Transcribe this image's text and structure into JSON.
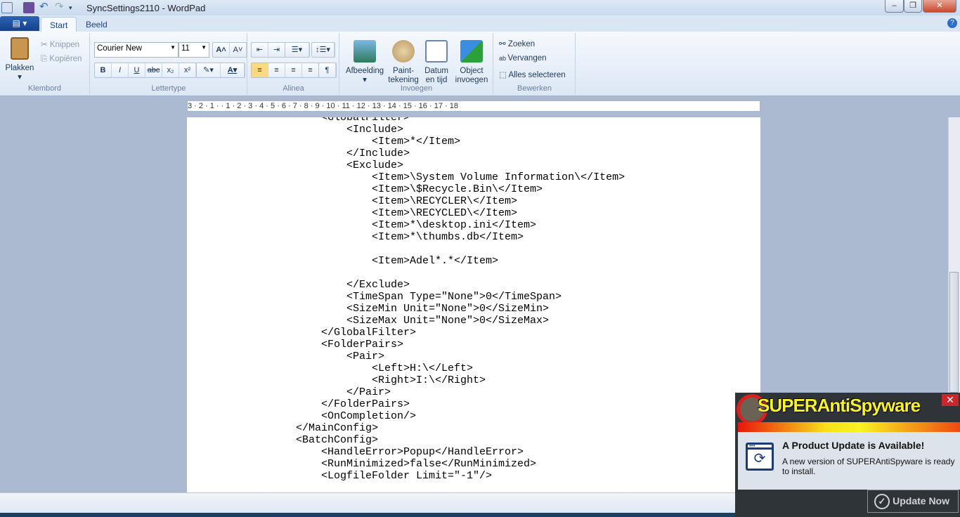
{
  "window": {
    "title": "SyncSettings2110 - WordPad"
  },
  "tabs": [
    {
      "label": "Start"
    },
    {
      "label": "Beeld"
    }
  ],
  "ribbon": {
    "clipboard": {
      "label": "Klembord",
      "paste": "Plakken",
      "cut": "Knippen",
      "copy": "Kopiëren"
    },
    "font": {
      "label": "Lettertype",
      "family": "Courier New",
      "size": "11",
      "buttons": [
        "B",
        "I",
        "U",
        "abc",
        "x₂",
        "x²"
      ]
    },
    "paragraph": {
      "label": "Alinea"
    },
    "insert": {
      "label": "Invoegen",
      "picture": "Afbeelding",
      "paint": "Paint-\ntekening",
      "datetime": "Datum\nen tijd",
      "object": "Object\ninvoegen"
    },
    "edit": {
      "label": "Bewerken",
      "find": "Zoeken",
      "replace": "Vervangen",
      "select_all": "Alles selecteren"
    }
  },
  "ruler": "3 · 2 · 1 · · 1 · 2 · 3 · 4 · 5 · 6 · 7 · 8 · 9 · 10 · 11 · 12 · 13 · 14 · 15 · 16 · 17 · 18",
  "document": {
    "lines": [
      "    <GlobalFilter>",
      "        <Include>",
      "            <Item>*</Item>",
      "        </Include>",
      "        <Exclude>",
      "            <Item>\\System Volume Information\\</Item>",
      "            <Item>\\$Recycle.Bin\\</Item>",
      "            <Item>\\RECYCLER\\</Item>",
      "            <Item>\\RECYCLED\\</Item>",
      "            <Item>*\\desktop.ini</Item>",
      "            <Item>*\\thumbs.db</Item>",
      "",
      "            <Item>Adel*.*</Item>",
      "",
      "        </Exclude>",
      "        <TimeSpan Type=\"None\">0</TimeSpan>",
      "        <SizeMin Unit=\"None\">0</SizeMin>",
      "        <SizeMax Unit=\"None\">0</SizeMax>",
      "    </GlobalFilter>",
      "    <FolderPairs>",
      "        <Pair>",
      "            <Left>H:\\</Left>",
      "            <Right>I:\\</Right>",
      "        </Pair>",
      "    </FolderPairs>",
      "    <OnCompletion/>",
      "</MainConfig>",
      "<BatchConfig>",
      "    <HandleError>Popup</HandleError>",
      "    <RunMinimized>false</RunMinimized>",
      "    <LogfileFolder Limit=\"-1\"/>"
    ]
  },
  "popup": {
    "brand": "SUPERAntiSpyware",
    "title": "A Product Update is Available!",
    "message": "A new version of SUPERAntiSpyware is ready to install.",
    "button": "Update Now",
    "close": "✕"
  }
}
